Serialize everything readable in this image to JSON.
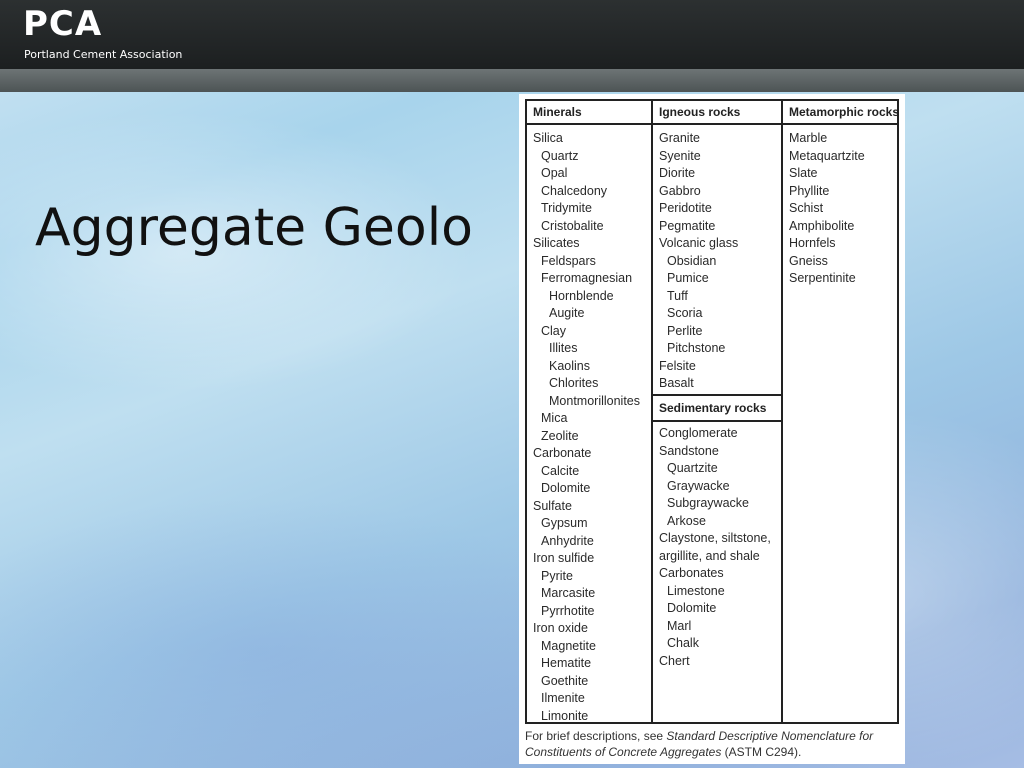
{
  "header": {
    "logo_text": "PCA",
    "logo_subtext": "Portland Cement Association"
  },
  "slide": {
    "title": "Aggregate Geolo"
  },
  "table": {
    "minerals": {
      "header": "Minerals",
      "items": [
        {
          "text": "Silica",
          "level": 0
        },
        {
          "text": "Quartz",
          "level": 1
        },
        {
          "text": "Opal",
          "level": 1
        },
        {
          "text": "Chalcedony",
          "level": 1
        },
        {
          "text": "Tridymite",
          "level": 1
        },
        {
          "text": "Cristobalite",
          "level": 1
        },
        {
          "text": "Silicates",
          "level": 0
        },
        {
          "text": "Feldspars",
          "level": 1
        },
        {
          "text": "Ferromagnesian",
          "level": 1
        },
        {
          "text": "Hornblende",
          "level": 2
        },
        {
          "text": "Augite",
          "level": 2
        },
        {
          "text": "Clay",
          "level": 1
        },
        {
          "text": "Illites",
          "level": 2
        },
        {
          "text": "Kaolins",
          "level": 2
        },
        {
          "text": "Chlorites",
          "level": 2
        },
        {
          "text": "Montmorillonites",
          "level": 2
        },
        {
          "text": "Mica",
          "level": 1
        },
        {
          "text": "Zeolite",
          "level": 1
        },
        {
          "text": "Carbonate",
          "level": 0
        },
        {
          "text": "Calcite",
          "level": 1
        },
        {
          "text": "Dolomite",
          "level": 1
        },
        {
          "text": "Sulfate",
          "level": 0
        },
        {
          "text": "Gypsum",
          "level": 1
        },
        {
          "text": "Anhydrite",
          "level": 1
        },
        {
          "text": "Iron sulfide",
          "level": 0
        },
        {
          "text": "Pyrite",
          "level": 1
        },
        {
          "text": "Marcasite",
          "level": 1
        },
        {
          "text": "Pyrrhotite",
          "level": 1
        },
        {
          "text": "Iron oxide",
          "level": 0
        },
        {
          "text": "Magnetite",
          "level": 1
        },
        {
          "text": "Hematite",
          "level": 1
        },
        {
          "text": "Goethite",
          "level": 1
        },
        {
          "text": "Ilmenite",
          "level": 1
        },
        {
          "text": "Limonite",
          "level": 1
        }
      ]
    },
    "igneous": {
      "header": "Igneous rocks",
      "items": [
        {
          "text": "Granite",
          "level": 0
        },
        {
          "text": "Syenite",
          "level": 0
        },
        {
          "text": "Diorite",
          "level": 0
        },
        {
          "text": "Gabbro",
          "level": 0
        },
        {
          "text": "Peridotite",
          "level": 0
        },
        {
          "text": "Pegmatite",
          "level": 0
        },
        {
          "text": "Volcanic glass",
          "level": 0
        },
        {
          "text": "Obsidian",
          "level": 1
        },
        {
          "text": "Pumice",
          "level": 1
        },
        {
          "text": "Tuff",
          "level": 1
        },
        {
          "text": "Scoria",
          "level": 1
        },
        {
          "text": "Perlite",
          "level": 1
        },
        {
          "text": "Pitchstone",
          "level": 1
        },
        {
          "text": "Felsite",
          "level": 0
        },
        {
          "text": "Basalt",
          "level": 0
        }
      ]
    },
    "sedimentary": {
      "header": "Sedimentary rocks",
      "items": [
        {
          "text": "Conglomerate",
          "level": 0
        },
        {
          "text": "Sandstone",
          "level": 0
        },
        {
          "text": "Quartzite",
          "level": 1
        },
        {
          "text": "Graywacke",
          "level": 1
        },
        {
          "text": "Subgraywacke",
          "level": 1
        },
        {
          "text": "Arkose",
          "level": 1
        },
        {
          "text": "Claystone, siltstone,",
          "level": 0
        },
        {
          "text": "argillite, and shale",
          "level": 0
        },
        {
          "text": "Carbonates",
          "level": 0
        },
        {
          "text": "Limestone",
          "level": 1
        },
        {
          "text": "Dolomite",
          "level": 1
        },
        {
          "text": "Marl",
          "level": 1
        },
        {
          "text": "Chalk",
          "level": 1
        },
        {
          "text": "Chert",
          "level": 0
        }
      ]
    },
    "metamorphic": {
      "header": "Metamorphic rocks",
      "items": [
        {
          "text": "Marble",
          "level": 0
        },
        {
          "text": "Metaquartzite",
          "level": 0
        },
        {
          "text": "Slate",
          "level": 0
        },
        {
          "text": "Phyllite",
          "level": 0
        },
        {
          "text": "Schist",
          "level": 0
        },
        {
          "text": "Amphibolite",
          "level": 0
        },
        {
          "text": "Hornfels",
          "level": 0
        },
        {
          "text": "Gneiss",
          "level": 0
        },
        {
          "text": "Serpentinite",
          "level": 0
        }
      ]
    }
  },
  "footnote": {
    "prefix": "For brief descriptions, see ",
    "citation_title": "Standard Descriptive Nomenclature for Constituents of Concrete Aggregates",
    "suffix": " (ASTM C294)."
  }
}
